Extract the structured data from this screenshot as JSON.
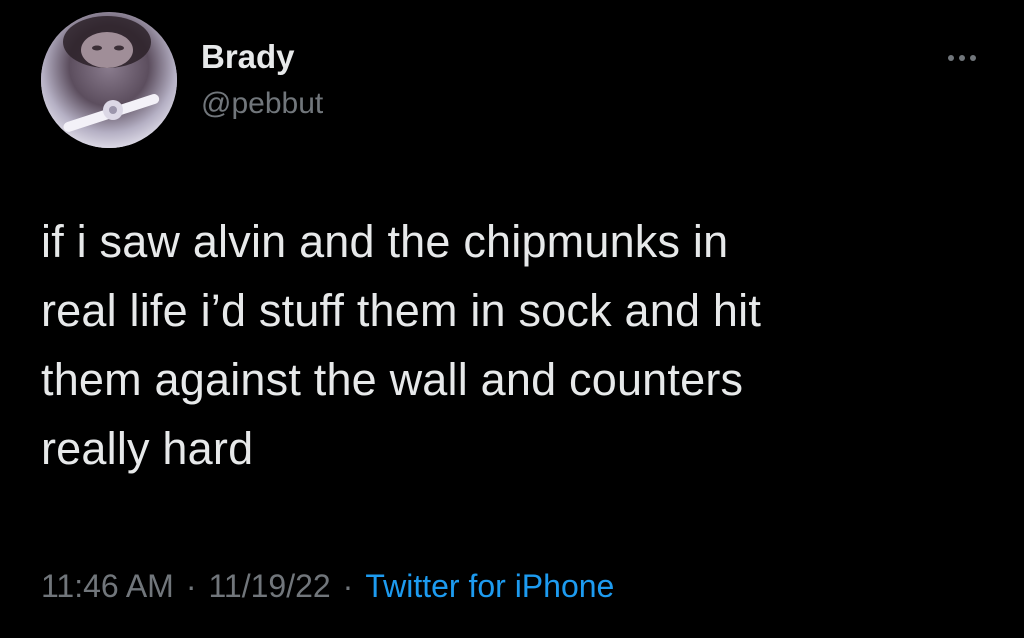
{
  "author": {
    "display_name": "Brady",
    "handle": "@pebbut",
    "avatar_icon": "profile-photo"
  },
  "more_icon": "ellipsis-icon",
  "tweet": {
    "text": "if i saw alvin and the chipmunks in\nreal life i’d stuff them in sock and hit\nthem against the wall and counters\nreally hard"
  },
  "meta": {
    "time": "11:46 AM",
    "separator": "·",
    "date": "11/19/22",
    "source": "Twitter for iPhone"
  },
  "colors": {
    "background": "#000000",
    "primary_text": "#e7e9ea",
    "secondary_text": "#71767b",
    "link": "#1d9bf0"
  }
}
